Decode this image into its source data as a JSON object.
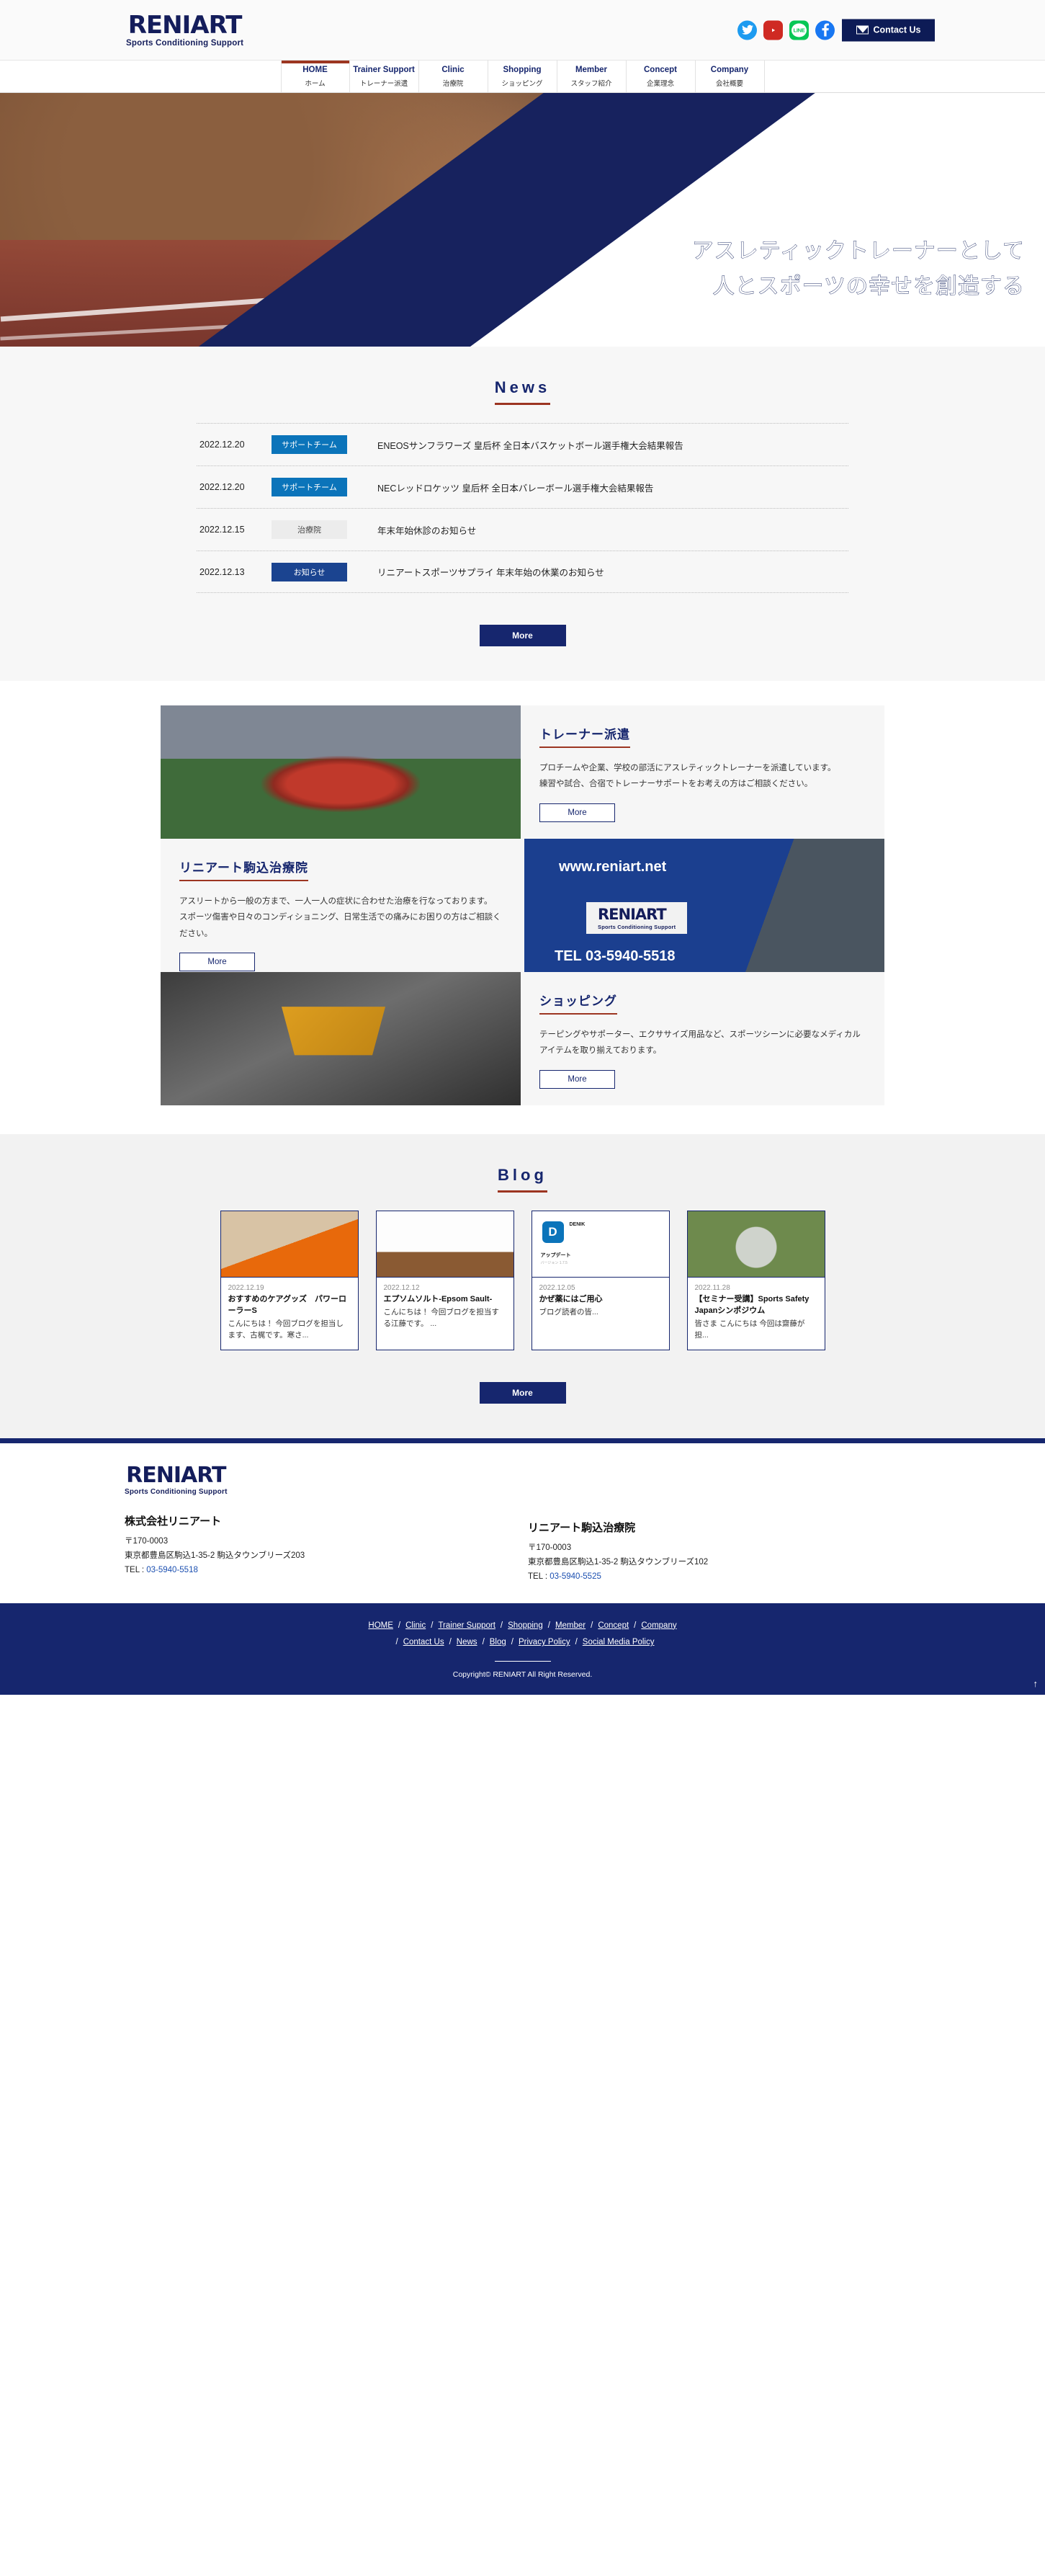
{
  "brand": {
    "word": "RENIART",
    "tagline": "Sports Conditioning Support"
  },
  "header": {
    "social": [
      {
        "name": "twitter-icon",
        "label": "Twitter",
        "color": "#1d9bf0"
      },
      {
        "name": "youtube-icon",
        "label": "YouTube",
        "color": "#cf2a23"
      },
      {
        "name": "line-icon",
        "label": "LINE",
        "color": "#06c755"
      },
      {
        "name": "facebook-icon",
        "label": "Facebook",
        "color": "#1877f2"
      }
    ],
    "contact_label": "Contact Us"
  },
  "nav": [
    {
      "en": "HOME",
      "jp": "ホーム",
      "active": true
    },
    {
      "en": "Trainer Support",
      "jp": "トレーナー派遣",
      "active": false
    },
    {
      "en": "Clinic",
      "jp": "治療院",
      "active": false
    },
    {
      "en": "Shopping",
      "jp": "ショッピング",
      "active": false
    },
    {
      "en": "Member",
      "jp": "スタッフ紹介",
      "active": false
    },
    {
      "en": "Concept",
      "jp": "企業理念",
      "active": false
    },
    {
      "en": "Company",
      "jp": "会社概要",
      "active": false
    }
  ],
  "hero": {
    "line1": "アスレティックトレーナーとして",
    "line2": "人とスポーツの幸せを創造する"
  },
  "news": {
    "title": "News",
    "more_label": "More",
    "items": [
      {
        "date": "2022.12.20",
        "category": "サポートチーム",
        "cat_style": "cat-support",
        "text": "ENEOSサンフラワーズ 皇后杯 全日本バスケットボール選手権大会結果報告"
      },
      {
        "date": "2022.12.20",
        "category": "サポートチーム",
        "cat_style": "cat-support",
        "text": "NECレッドロケッツ 皇后杯 全日本バレーボール選手権大会結果報告"
      },
      {
        "date": "2022.12.15",
        "category": "治療院",
        "cat_style": "cat-clinic",
        "text": "年末年始休診のお知らせ"
      },
      {
        "date": "2022.12.13",
        "category": "お知らせ",
        "cat_style": "cat-info",
        "text": "リニアートスポーツサプライ 年末年始の休業のお知らせ"
      }
    ]
  },
  "services": [
    {
      "heading": "トレーナー派遣",
      "body": "プロチームや企業、学校の部活にアスレティックトレーナーを派遣しています。\n練習や試合、合宿でトレーナーサポートをお考えの方はご相談ください。",
      "more_label": "More",
      "image_name": "rugby-team-photo"
    },
    {
      "heading": "リニアート駒込治療院",
      "body": "アスリートから一般の方まで、一人一人の症状に合わせた治療を行なっております。\nスポーツ傷害や日々のコンディショニング、日常生活での痛みにお困りの方はご相談ください。",
      "more_label": "More",
      "image_name": "clinic-storefront-photo",
      "image_url_text": "www.reniart.net",
      "image_tel_text": "TEL 03-5940-5518"
    },
    {
      "heading": "ショッピング",
      "body": "テーピングやサポーター、エクササイズ用品など、スポーツシーンに必要なメディカルアイテムを取り揃えております。",
      "more_label": "More",
      "image_name": "shopping-cart-keyboard-photo"
    }
  ],
  "blog": {
    "title": "Blog",
    "more_label": "More",
    "posts": [
      {
        "date": "2022.12.19",
        "title": "おすすめのケアグッズ　パワーローラーS",
        "excerpt": "こんにちは！ 今回ブログを担当します、古梶です。寒さ...",
        "thumb_name": "power-roller-photo"
      },
      {
        "date": "2022.12.12",
        "title": "エプソムソルト-Epsom Sault-",
        "excerpt": "こんにちは！ 今回ブログを担当する江藤です。 ...",
        "thumb_name": "epsom-salt-photo"
      },
      {
        "date": "2022.12.05",
        "title": "かぜ薬にはご用心",
        "excerpt": "ブログ読者の皆...",
        "thumb_name": "app-screenshot",
        "thumb_app_title": "アップデート",
        "thumb_app_version": "バージョン 1.7.5",
        "thumb_app_letter": "D",
        "thumb_app_name": "DENIK"
      },
      {
        "date": "2022.11.28",
        "title": "【セミナー受講】Sports Safety　Japanシンポジウム",
        "excerpt": "皆さま こんにちは 今回は齋藤が担...",
        "thumb_name": "wbgt-meter-photo"
      }
    ]
  },
  "footer": {
    "company": {
      "name": "株式会社リニアート",
      "postal": "〒170-0003",
      "address": "東京都豊島区駒込1-35-2 駒込タウンブリーズ203",
      "tel_label": "TEL : ",
      "tel": "03-5940-5518"
    },
    "clinic": {
      "name": "リニアート駒込治療院",
      "postal": "〒170-0003",
      "address": "東京都豊島区駒込1-35-2 駒込タウンブリーズ102",
      "tel_label": "TEL : ",
      "tel": "03-5940-5525"
    },
    "links_row1": [
      "HOME",
      "Clinic",
      "Trainer Support",
      "Shopping",
      "Member",
      "Concept",
      "Company"
    ],
    "links_row2": [
      "Contact Us",
      "News",
      "Blog",
      "Privacy Policy",
      "Social Media Policy"
    ],
    "copyright": "Copyright© RENIART All Right Reserved.",
    "to_top": "↑"
  },
  "colors": {
    "navy": "#16266e",
    "deep_navy": "#0d1b56",
    "accent_red": "#9c3521",
    "support_blue": "#0b74ba",
    "info_blue": "#1b4490"
  }
}
